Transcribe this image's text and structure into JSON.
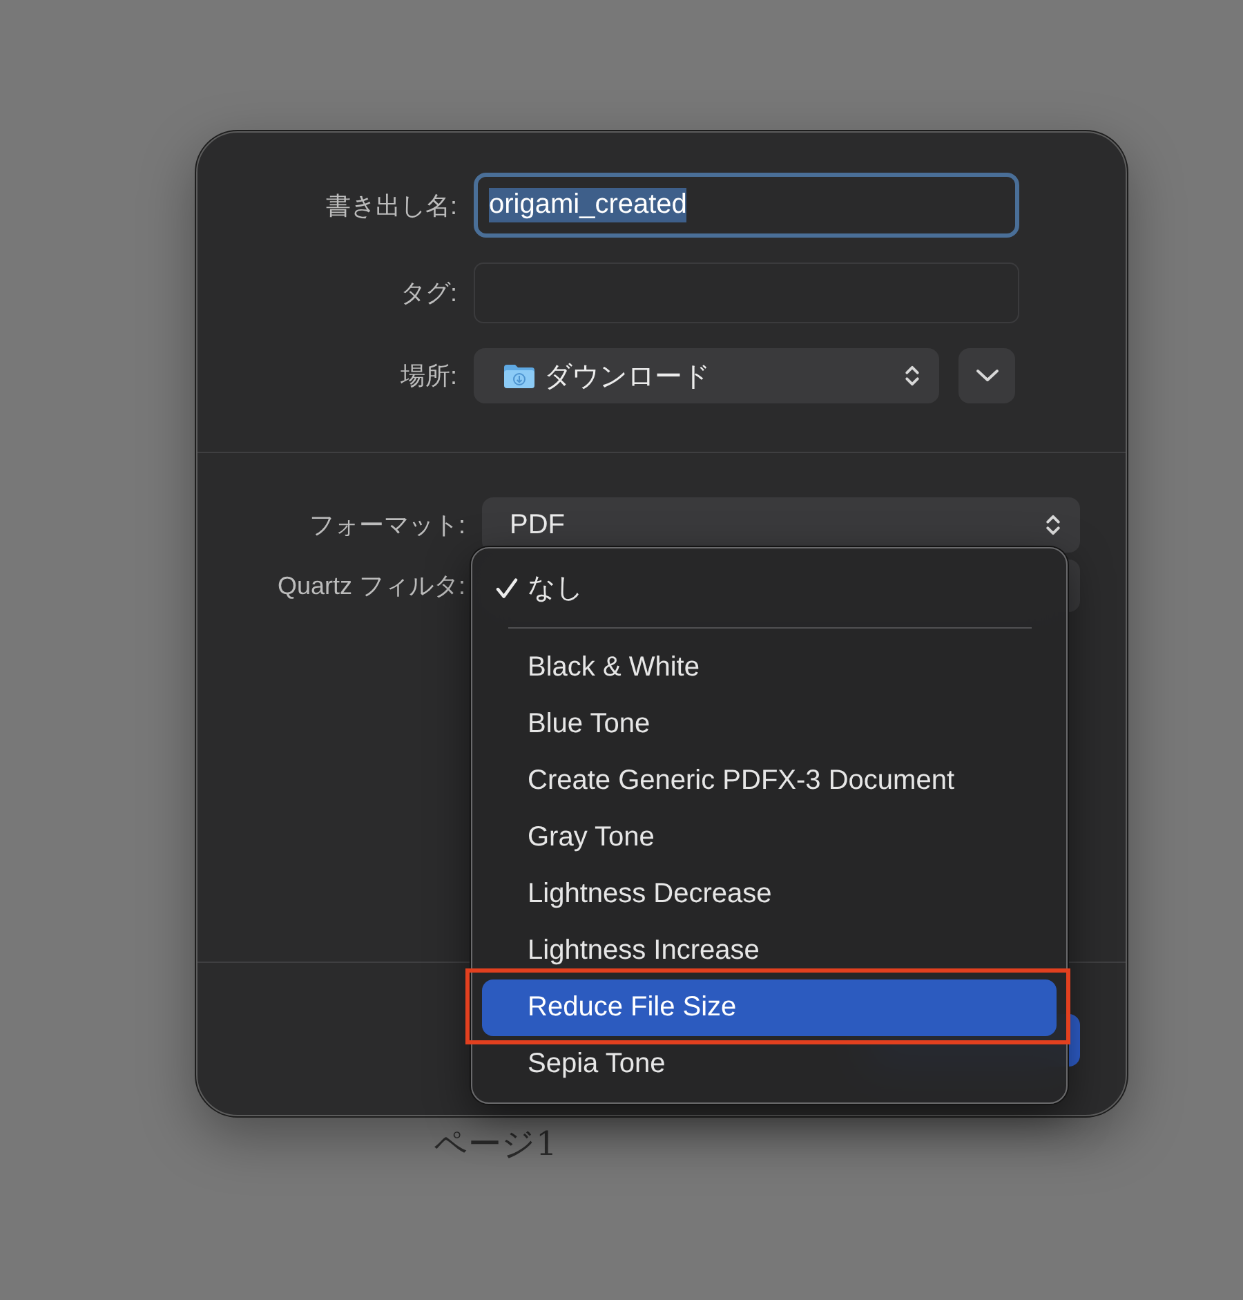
{
  "dialog": {
    "fields": [
      {
        "kind": "text",
        "label": "書き出し名:",
        "value": "origami_created",
        "focused": true,
        "text_selected": true
      },
      {
        "kind": "text",
        "label": "タグ:",
        "focused": false
      },
      {
        "kind": "location",
        "label": "場所:",
        "value": "ダウンロード",
        "expanded": false
      }
    ],
    "format": {
      "label": "フォーマット:",
      "value": "PDF"
    },
    "filter": {
      "label": "Quartz フィルタ:",
      "menu_open": true,
      "menu": [
        {
          "kind": "option",
          "label": "なし",
          "selected": true,
          "highlighted": false,
          "outlined": false
        },
        {
          "kind": "separator"
        },
        {
          "kind": "option",
          "label": "Black & White",
          "selected": false,
          "highlighted": false,
          "outlined": false
        },
        {
          "kind": "option",
          "label": "Blue Tone",
          "selected": false,
          "highlighted": false,
          "outlined": false
        },
        {
          "kind": "option",
          "label": "Create Generic PDFX-3 Document",
          "selected": false,
          "highlighted": false,
          "outlined": false
        },
        {
          "kind": "option",
          "label": "Gray Tone",
          "selected": false,
          "highlighted": false,
          "outlined": false
        },
        {
          "kind": "option",
          "label": "Lightness Decrease",
          "selected": false,
          "highlighted": false,
          "outlined": false
        },
        {
          "kind": "option",
          "label": "Lightness Increase",
          "selected": false,
          "highlighted": false,
          "outlined": false
        },
        {
          "kind": "option",
          "label": "Reduce File Size",
          "selected": false,
          "highlighted": true,
          "outlined": true
        },
        {
          "kind": "option",
          "label": "Sepia Tone",
          "selected": false,
          "highlighted": false,
          "outlined": false
        }
      ]
    }
  },
  "page_text": "ページ1"
}
